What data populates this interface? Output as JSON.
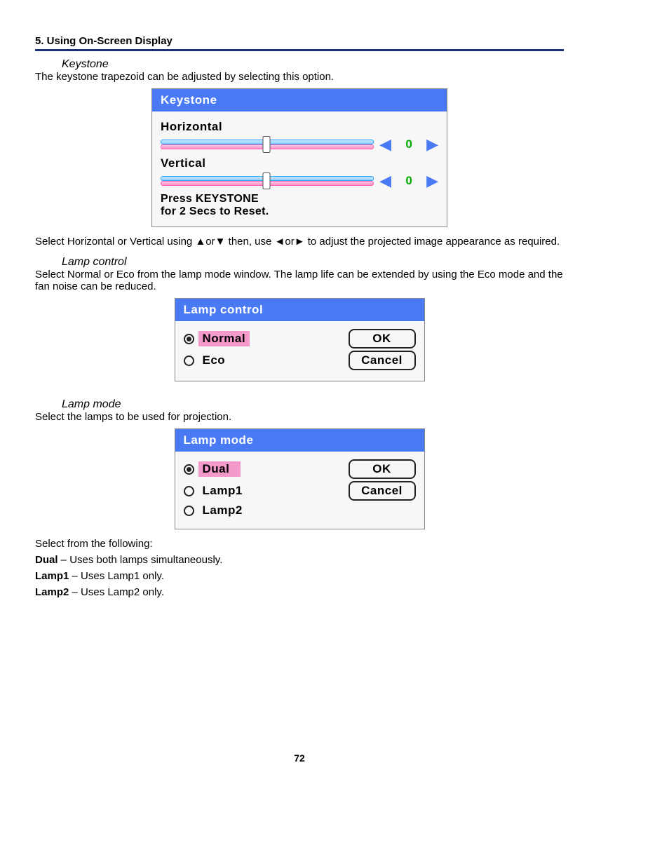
{
  "header": "5. Using On-Screen Display",
  "keystone": {
    "heading": "Keystone",
    "intro": "The keystone trapezoid can be adjusted by selecting this option.",
    "title": "Keystone",
    "h_label": "Horizontal",
    "h_value": "0",
    "v_label": "Vertical",
    "v_value": "0",
    "hint1": "Press KEYSTONE",
    "hint2": "for 2 Secs to Reset.",
    "instruction_pre": "Select Horizontal or Vertical using ",
    "instruction_mid": " then, use ",
    "instruction_post": " to adjust the projected image appearance as required.",
    "arrows_ud": "▲or▼",
    "arrows_lr": "◄or►"
  },
  "lampctrl": {
    "heading": "Lamp control",
    "intro": "Select Normal or Eco from the lamp mode window. The lamp life can be extended by using the Eco mode and the fan noise can be reduced.",
    "title": "Lamp control",
    "opt1": "Normal",
    "opt2": "Eco",
    "ok": "OK",
    "cancel": "Cancel"
  },
  "lampmode": {
    "heading": "Lamp mode",
    "intro": "Select the lamps to be used for projection.",
    "title": "Lamp mode",
    "opt1": "Dual",
    "opt2": "Lamp1",
    "opt3": "Lamp2",
    "ok": "OK",
    "cancel": "Cancel"
  },
  "followup": {
    "lead": "Select from the following:",
    "d_bold": "Dual",
    "d_rest": " – Uses both lamps simultaneously.",
    "l1_bold": "Lamp1",
    "l1_rest": " – Uses Lamp1 only.",
    "l2_bold": "Lamp2",
    "l2_rest": " – Uses Lamp2 only."
  },
  "page": "72"
}
